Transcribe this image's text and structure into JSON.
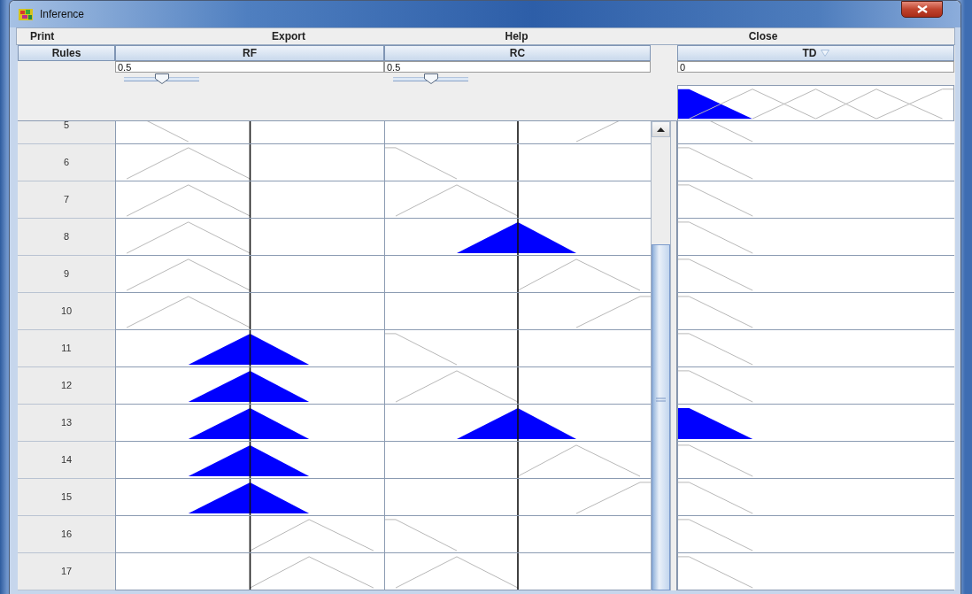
{
  "window": {
    "title": "Inference"
  },
  "menu": [
    {
      "label": "Print"
    },
    {
      "label": "Export"
    },
    {
      "label": "Help"
    },
    {
      "label": "Close"
    }
  ],
  "table": {
    "rules_label": "Rules",
    "inputs": [
      {
        "label": "RF",
        "value": "0.5",
        "slider": {
          "level": 0.5
        }
      },
      {
        "label": "RC",
        "value": "0.5",
        "slider": {
          "level": 0.5
        }
      }
    ],
    "output": {
      "label": "TD",
      "value": "0",
      "aggregate": [
        {
          "kind": "leftshoulder",
          "active": true
        },
        {
          "kind": "low",
          "active": false
        },
        {
          "kind": "mid",
          "active": false
        },
        {
          "kind": "high",
          "active": false
        },
        {
          "kind": "rightshoulder",
          "active": false
        }
      ]
    },
    "rows": [
      {
        "rule": "5",
        "cells": [
          {
            "kind": "leftshoulder",
            "active": false
          },
          {
            "kind": "rightshoulder",
            "active": false
          }
        ],
        "output": {
          "kind": "leftshoulder",
          "active": false
        }
      },
      {
        "rule": "6",
        "cells": [
          {
            "kind": "low",
            "active": false
          },
          {
            "kind": "leftshoulder",
            "active": false
          }
        ],
        "output": {
          "kind": "leftshoulder",
          "active": false
        }
      },
      {
        "rule": "7",
        "cells": [
          {
            "kind": "low",
            "active": false
          },
          {
            "kind": "low",
            "active": false
          }
        ],
        "output": {
          "kind": "leftshoulder",
          "active": false
        }
      },
      {
        "rule": "8",
        "cells": [
          {
            "kind": "low",
            "active": false
          },
          {
            "kind": "mid",
            "active": true
          }
        ],
        "output": {
          "kind": "leftshoulder",
          "active": false
        }
      },
      {
        "rule": "9",
        "cells": [
          {
            "kind": "low",
            "active": false
          },
          {
            "kind": "high",
            "active": false
          }
        ],
        "output": {
          "kind": "leftshoulder",
          "active": false
        }
      },
      {
        "rule": "10",
        "cells": [
          {
            "kind": "low",
            "active": false
          },
          {
            "kind": "rightshoulder",
            "active": false
          }
        ],
        "output": {
          "kind": "leftshoulder",
          "active": false
        }
      },
      {
        "rule": "11",
        "cells": [
          {
            "kind": "mid",
            "active": true
          },
          {
            "kind": "leftshoulder",
            "active": false
          }
        ],
        "output": {
          "kind": "leftshoulder",
          "active": false
        }
      },
      {
        "rule": "12",
        "cells": [
          {
            "kind": "mid",
            "active": true
          },
          {
            "kind": "low",
            "active": false
          }
        ],
        "output": {
          "kind": "leftshoulder",
          "active": false
        }
      },
      {
        "rule": "13",
        "cells": [
          {
            "kind": "mid",
            "active": true
          },
          {
            "kind": "mid",
            "active": true
          }
        ],
        "output": {
          "kind": "leftshoulder",
          "active": true
        }
      },
      {
        "rule": "14",
        "cells": [
          {
            "kind": "mid",
            "active": true
          },
          {
            "kind": "high",
            "active": false
          }
        ],
        "output": {
          "kind": "leftshoulder",
          "active": false
        }
      },
      {
        "rule": "15",
        "cells": [
          {
            "kind": "mid",
            "active": true
          },
          {
            "kind": "rightshoulder",
            "active": false
          }
        ],
        "output": {
          "kind": "leftshoulder",
          "active": false
        }
      },
      {
        "rule": "16",
        "cells": [
          {
            "kind": "high",
            "active": false
          },
          {
            "kind": "leftshoulder",
            "active": false
          }
        ],
        "output": {
          "kind": "leftshoulder",
          "active": false
        }
      },
      {
        "rule": "17",
        "cells": [
          {
            "kind": "high",
            "active": false
          },
          {
            "kind": "low",
            "active": false
          }
        ],
        "output": {
          "kind": "leftshoulder",
          "active": false
        }
      }
    ]
  }
}
